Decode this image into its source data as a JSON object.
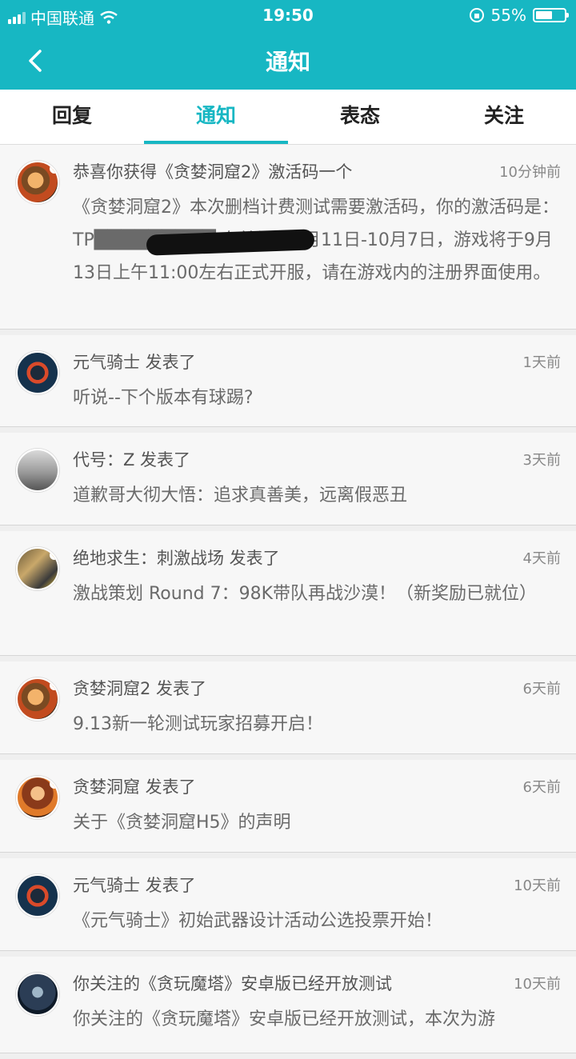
{
  "status": {
    "carrier": "中国联通",
    "time": "19:50",
    "battery": "55%"
  },
  "nav": {
    "title": "通知"
  },
  "tabs": [
    {
      "label": "回复",
      "active": false
    },
    {
      "label": "通知",
      "active": true
    },
    {
      "label": "表态",
      "active": false
    },
    {
      "label": "关注",
      "active": false
    }
  ],
  "notifications": [
    {
      "title": "恭喜你获得《贪婪洞窟2》激活码一个",
      "time": "10分钟前",
      "body": "《贪婪洞窟2》本次删档计费测试需要激活码，你的激活码是：TP█████████ 有效期：9月11日-10月7日，游戏将于9月13日上午11:00左右正式开服，请在游戏内的注册界面使用。"
    },
    {
      "title": "元气骑士 发表了",
      "time": "1天前",
      "body": "听说--下个版本有球踢?"
    },
    {
      "title": "代号：Z 发表了",
      "time": "3天前",
      "body": "道歉哥大彻大悟：追求真善美，远离假恶丑"
    },
    {
      "title": "绝地求生：刺激战场 发表了",
      "time": "4天前",
      "body": "激战策划 Round 7：98K带队再战沙漠！（新奖励已就位）"
    },
    {
      "title": "贪婪洞窟2 发表了",
      "time": "6天前",
      "body": "9.13新一轮测试玩家招募开启！"
    },
    {
      "title": "贪婪洞窟 发表了",
      "time": "6天前",
      "body": "关于《贪婪洞窟H5》的声明"
    },
    {
      "title": "元气骑士 发表了",
      "time": "10天前",
      "body": "《元气骑士》初始武器设计活动公选投票开始！"
    },
    {
      "title": "你关注的《贪玩魔塔》安卓版已经开放测试",
      "time": "10天前",
      "body": "你关注的《贪玩魔塔》安卓版已经开放测试，本次为游"
    }
  ]
}
